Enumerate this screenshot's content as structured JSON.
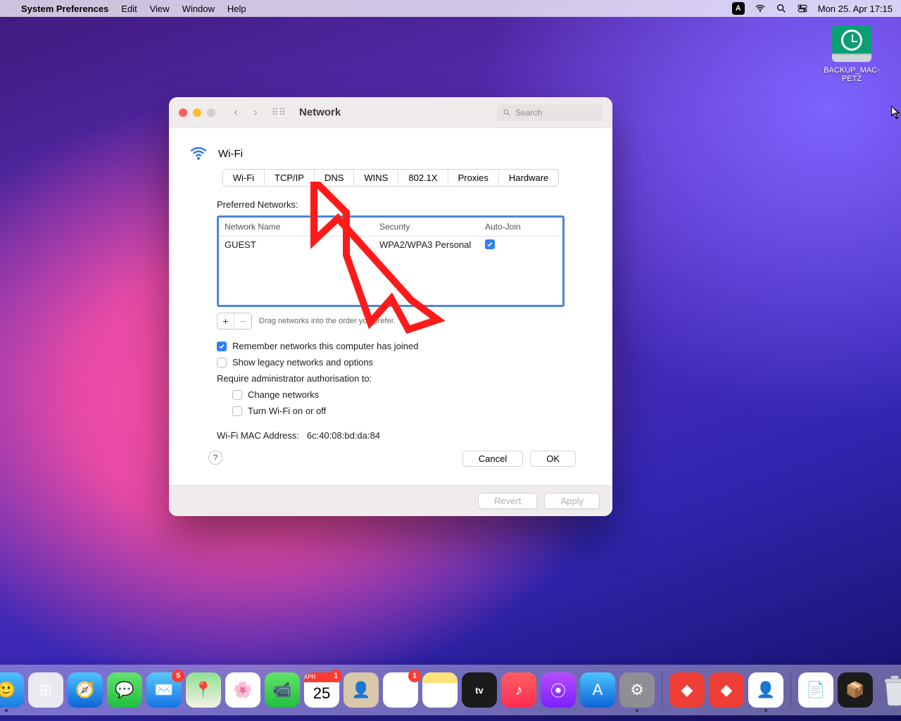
{
  "menubar": {
    "app_name": "System Preferences",
    "items": [
      "Edit",
      "View",
      "Window",
      "Help"
    ],
    "clock": "Mon 25. Apr  17:15",
    "input_badge": "A"
  },
  "desktop": {
    "disk_label": "BACKUP_MAC-PETZ"
  },
  "window": {
    "title": "Network",
    "search_placeholder": "Search",
    "heading": "Wi-Fi",
    "tabs": [
      "Wi-Fi",
      "TCP/IP",
      "DNS",
      "WINS",
      "802.1X",
      "Proxies",
      "Hardware"
    ],
    "active_tab": "Wi-Fi",
    "preferred_label": "Preferred Networks:",
    "columns": {
      "name": "Network Name",
      "security": "Security",
      "autojoin": "Auto-Join"
    },
    "rows": [
      {
        "name": "GUEST",
        "security": "WPA2/WPA3 Personal",
        "autojoin": true
      }
    ],
    "drag_hint": "Drag networks into the order you prefer.",
    "remember": "Remember networks this computer has joined",
    "legacy": "Show legacy networks and options",
    "require_label": "Require administrator authorisation to:",
    "opt_change": "Change networks",
    "opt_power": "Turn Wi-Fi on or off",
    "mac_label": "Wi-Fi MAC Address:",
    "mac_value": "6c:40:08:bd:da:84",
    "btn_cancel": "Cancel",
    "btn_ok": "OK",
    "btn_revert": "Revert",
    "btn_apply": "Apply",
    "help": "?"
  },
  "dock": {
    "apps": [
      {
        "name": "finder",
        "bg": "linear-gradient(#4ec0ff,#1a7de0)",
        "glyph": "🙂",
        "running": true
      },
      {
        "name": "launchpad",
        "bg": "#e9e9ef",
        "glyph": "⊞"
      },
      {
        "name": "safari",
        "bg": "linear-gradient(#4fc4ff,#0d63d6)",
        "glyph": "🧭"
      },
      {
        "name": "messages",
        "bg": "linear-gradient(#64e36b,#1fbf3f)",
        "glyph": "💬"
      },
      {
        "name": "mail",
        "bg": "linear-gradient(#5ac8fa,#1772e8)",
        "glyph": "✉️",
        "badge": "5"
      },
      {
        "name": "maps",
        "bg": "linear-gradient(#8fe08f,#f5f1e6)",
        "glyph": "📍"
      },
      {
        "name": "photos",
        "bg": "#fff",
        "glyph": "🌸"
      },
      {
        "name": "facetime",
        "bg": "linear-gradient(#64e36b,#1fbf3f)",
        "glyph": "📹"
      },
      {
        "name": "calendar",
        "bg": "#fff",
        "glyph": "25",
        "badge": "1"
      },
      {
        "name": "contacts",
        "bg": "#d8c7a8",
        "glyph": "👤"
      },
      {
        "name": "reminders",
        "bg": "#fff",
        "glyph": "☰",
        "badge": "1"
      },
      {
        "name": "notes",
        "bg": "linear-gradient(#ffe27a 30%,#fff 30%)",
        "glyph": ""
      },
      {
        "name": "tv",
        "bg": "#1b1b1b",
        "glyph": "tv"
      },
      {
        "name": "music",
        "bg": "linear-gradient(#ff5e62,#ff2d55)",
        "glyph": "♪"
      },
      {
        "name": "podcasts",
        "bg": "linear-gradient(#b84eff,#7b1fff)",
        "glyph": "⦿"
      },
      {
        "name": "appstore",
        "bg": "linear-gradient(#4fc4ff,#0d63d6)",
        "glyph": "A"
      },
      {
        "name": "preferences",
        "bg": "#8e8e93",
        "glyph": "⚙︎",
        "running": true
      }
    ],
    "extras": [
      {
        "name": "anydesk",
        "bg": "#ef3e36",
        "glyph": "◆"
      },
      {
        "name": "anydesk2",
        "bg": "#ef3e36",
        "glyph": "◆"
      },
      {
        "name": "user",
        "bg": "#fff",
        "glyph": "👤",
        "running": true
      }
    ],
    "files": [
      {
        "name": "textdoc",
        "bg": "#fdfdfd",
        "glyph": "📄"
      },
      {
        "name": "pkg",
        "bg": "#1b1b1b",
        "glyph": "📦"
      }
    ]
  }
}
